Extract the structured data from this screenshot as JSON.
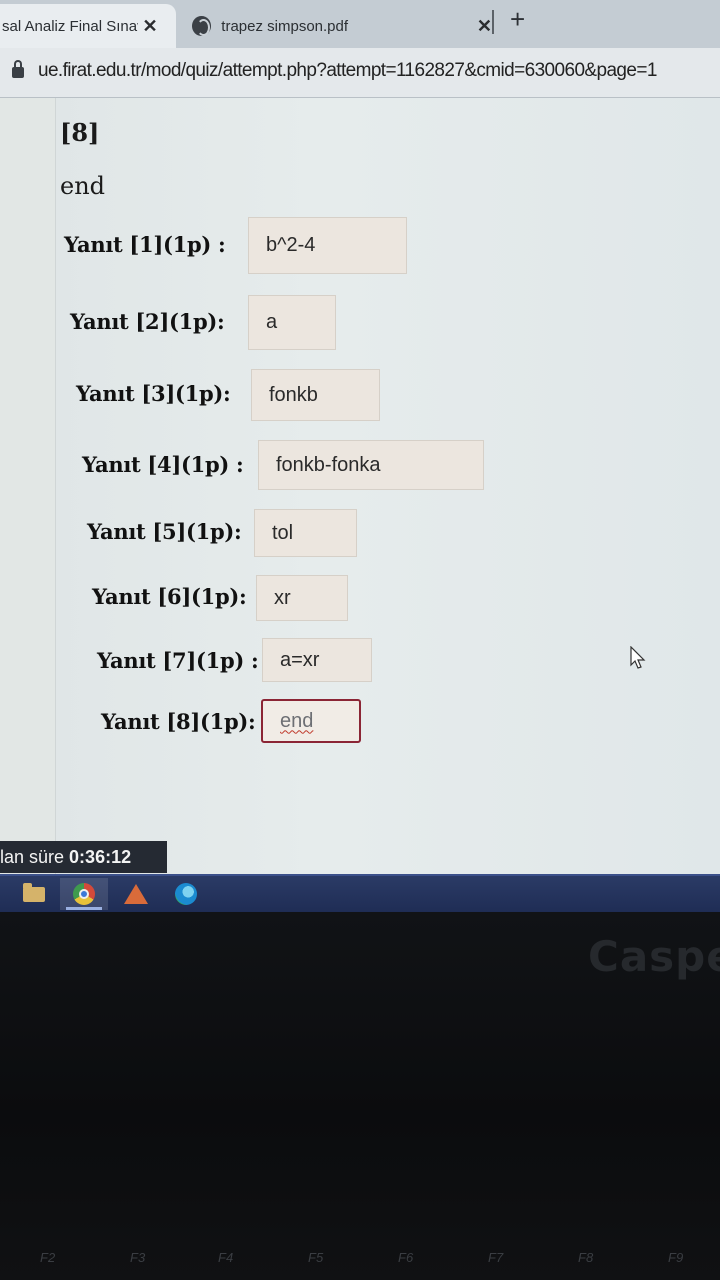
{
  "browser": {
    "tabs": [
      {
        "title": "sal Analiz Final Sınav",
        "active": true
      },
      {
        "title": "trapez simpson.pdf",
        "active": false
      }
    ],
    "new_tab_label": "+",
    "close_label": "✕",
    "url": "ue.firat.edu.tr/mod/quiz/attempt.php?attempt=1162827&cmid=630060&page=1"
  },
  "question": {
    "number_label": "[8]",
    "code_line": "end"
  },
  "answers": [
    {
      "label": "Yanıt [1](1p) :",
      "value": "b^2-4"
    },
    {
      "label": "Yanıt [2](1p):",
      "value": "a"
    },
    {
      "label": "Yanıt [3](1p):",
      "value": "fonkb"
    },
    {
      "label": "Yanıt [4](1p) :",
      "value": "fonkb-fonka"
    },
    {
      "label": "Yanıt [5](1p):",
      "value": "tol"
    },
    {
      "label": "Yanıt [6](1p):",
      "value": "xr"
    },
    {
      "label": "Yanıt [7](1p) :",
      "value": "a=xr"
    },
    {
      "label": "Yanıt [8](1p):",
      "value": "end",
      "focused": true
    }
  ],
  "timer": {
    "label": "lan süre",
    "value": "0:36:12"
  },
  "taskbar": {
    "icons": [
      "file-explorer-icon",
      "chrome-icon",
      "matlab-icon",
      "edge-icon"
    ]
  },
  "laptop": {
    "brand": "Caspe",
    "function_keys": [
      "F2",
      "F3",
      "F4",
      "F5",
      "F6",
      "F7",
      "F8",
      "F9"
    ]
  },
  "colors": {
    "focus_border": "#8b2535",
    "input_bg": "#ece6df",
    "taskbar": "#2b3b66"
  }
}
